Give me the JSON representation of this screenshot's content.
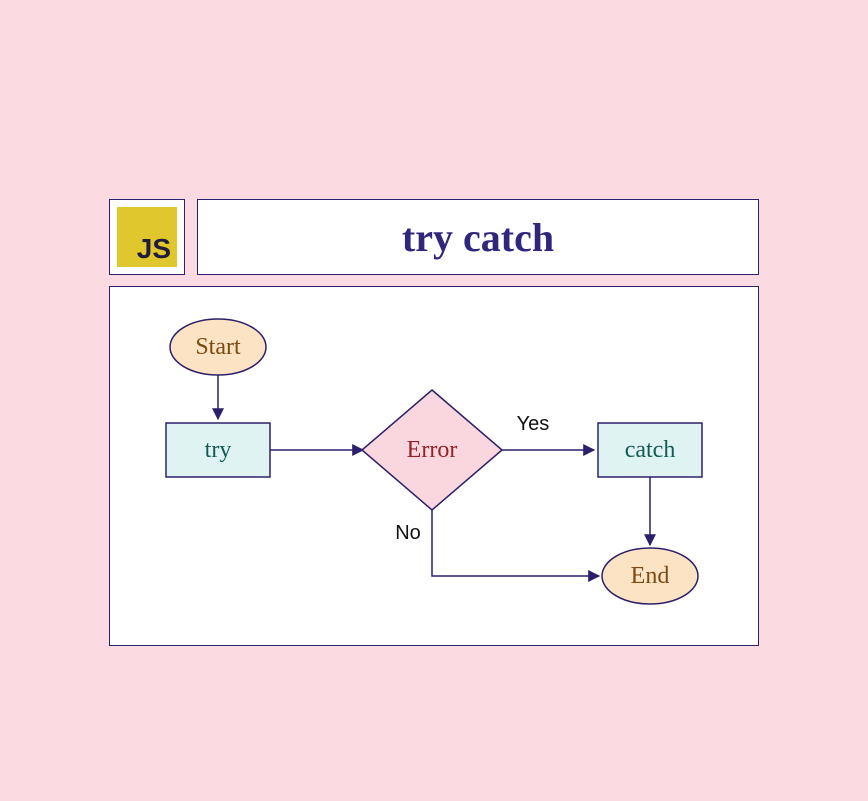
{
  "logo": {
    "label": "JS"
  },
  "title": "try catch",
  "flow": {
    "nodes": {
      "start": {
        "label": "Start"
      },
      "try": {
        "label": "try"
      },
      "error": {
        "label": "Error"
      },
      "catch": {
        "label": "catch"
      },
      "end": {
        "label": "End"
      }
    },
    "edges": {
      "yes": {
        "label": "Yes"
      },
      "no": {
        "label": "No"
      }
    },
    "colors": {
      "border": "#2c1f6b",
      "terminalFill": "#fce3c4",
      "processFill": "#dff3f2",
      "decisionFill": "#fad7de"
    }
  }
}
